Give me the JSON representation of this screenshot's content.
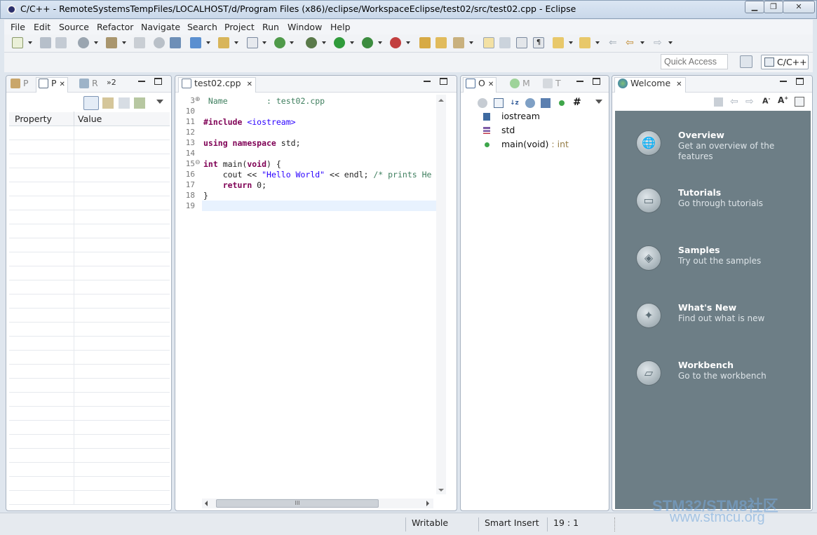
{
  "window": {
    "title": "C/C++ - RemoteSystemsTempFiles/LOCALHOST/d/Program Files (x86)/eclipse/WorkspaceEclipse/test02/src/test02.cpp - Eclipse",
    "minimize": "▁",
    "restore": "❐",
    "close": "✕"
  },
  "menu": [
    "File",
    "Edit",
    "Source",
    "Refactor",
    "Navigate",
    "Search",
    "Project",
    "Run",
    "Window",
    "Help"
  ],
  "quick_access": {
    "placeholder": "Quick Access"
  },
  "perspective": {
    "label": "C/C++"
  },
  "left_panel": {
    "tabs": [
      {
        "label": "P"
      },
      {
        "label": "P",
        "close": "✕"
      },
      {
        "label": "R"
      },
      {
        "label": "»2"
      }
    ],
    "columns": [
      "Property",
      "Value"
    ]
  },
  "editor": {
    "tab": {
      "label": "test02.cpp",
      "close": "✕"
    },
    "lines": [
      {
        "n": "3",
        "fold": "⊕",
        "parts": [
          {
            "t": " Name        : test02.cpp",
            "c": "com"
          }
        ]
      },
      {
        "n": "10",
        "parts": []
      },
      {
        "n": "11",
        "parts": [
          {
            "t": "#include ",
            "c": "kw"
          },
          {
            "t": "<iostream>",
            "c": "inc"
          }
        ]
      },
      {
        "n": "12",
        "parts": []
      },
      {
        "n": "13",
        "parts": [
          {
            "t": "using ",
            "c": "kw"
          },
          {
            "t": "namespace ",
            "c": "kw"
          },
          {
            "t": "std;",
            "c": ""
          }
        ]
      },
      {
        "n": "14",
        "parts": []
      },
      {
        "n": "15",
        "fold": "⊖",
        "parts": [
          {
            "t": "int ",
            "c": "kw"
          },
          {
            "t": "main(",
            "c": ""
          },
          {
            "t": "void",
            "c": "kw"
          },
          {
            "t": ") {",
            "c": ""
          }
        ]
      },
      {
        "n": "16",
        "parts": [
          {
            "t": "    cout << ",
            "c": ""
          },
          {
            "t": "\"Hello World\"",
            "c": "str"
          },
          {
            "t": " << endl; ",
            "c": ""
          },
          {
            "t": "/* prints He",
            "c": "com"
          }
        ]
      },
      {
        "n": "17",
        "parts": [
          {
            "t": "    ",
            "c": ""
          },
          {
            "t": "return ",
            "c": "kw"
          },
          {
            "t": "0;",
            "c": ""
          }
        ]
      },
      {
        "n": "18",
        "parts": [
          {
            "t": "}",
            "c": ""
          }
        ]
      },
      {
        "n": "19",
        "parts": []
      }
    ],
    "hscroll_grip": "III"
  },
  "outline_panel": {
    "tabs": [
      {
        "label": "O",
        "close": "✕"
      },
      {
        "label": "M"
      },
      {
        "label": "T"
      }
    ],
    "items": [
      {
        "label": "iostream",
        "suffix": "",
        "icon": "include-icon"
      },
      {
        "label": "std",
        "suffix": "",
        "icon": "namespace-icon"
      },
      {
        "label": "main(void)",
        "suffix": " : int",
        "icon": "function-icon"
      }
    ]
  },
  "welcome_panel": {
    "tab": {
      "label": "Welcome",
      "close": "✕"
    },
    "items": [
      {
        "title": "Overview",
        "desc": "Get an overview of the features",
        "icon": "globe-icon"
      },
      {
        "title": "Tutorials",
        "desc": "Go through tutorials",
        "icon": "tutorial-board-icon"
      },
      {
        "title": "Samples",
        "desc": "Try out the samples",
        "icon": "samples-cubes-icon"
      },
      {
        "title": "What's New",
        "desc": "Find out what is new",
        "icon": "star-sparkle-icon"
      },
      {
        "title": "Workbench",
        "desc": "Go to the workbench",
        "icon": "workbench-icon"
      }
    ]
  },
  "status": {
    "writable": "Writable",
    "insert_mode": "Smart Insert",
    "position": "19 : 1"
  },
  "watermark": {
    "line1": "STM32/STM8社区",
    "line2": "www.stmcu.org"
  },
  "colors": {
    "welcome_bg": "#6d7e86",
    "keyword": "#7f0055",
    "string": "#2a00ff",
    "comment": "#3f7f5f"
  }
}
